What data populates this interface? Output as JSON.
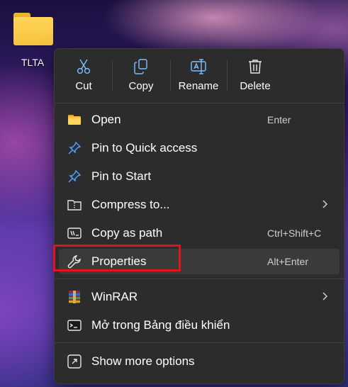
{
  "desktop": {
    "folder_label": "TLTA",
    "folder_icon": "folder-icon"
  },
  "toolbar": {
    "cut": "Cut",
    "copy": "Copy",
    "rename": "Rename",
    "delete": "Delete"
  },
  "menu_items": [
    {
      "label": "Open",
      "shortcut": "Enter",
      "icon": "folder-open-icon"
    },
    {
      "label": "Pin to Quick access",
      "icon": "pin-icon"
    },
    {
      "label": "Pin to Start",
      "icon": "pin-icon"
    },
    {
      "label": "Compress to...",
      "icon": "zip-folder-icon",
      "submenu": true
    },
    {
      "label": "Copy as path",
      "shortcut": "Ctrl+Shift+C",
      "icon": "path-icon"
    },
    {
      "label": "Properties",
      "shortcut": "Alt+Enter",
      "icon": "wrench-icon",
      "highlighted": true
    },
    {
      "label": "WinRAR",
      "icon": "winrar-icon",
      "submenu": true
    },
    {
      "label": "Mở trong Bảng điều khiển",
      "icon": "terminal-icon"
    },
    {
      "label": "Show more options",
      "icon": "share-icon"
    }
  ],
  "colors": {
    "menu_bg": "#2c2c2c",
    "highlight_border": "#e0141c",
    "accent_blue": "#4aa3ff",
    "folder_yellow": "#f5c23d"
  }
}
